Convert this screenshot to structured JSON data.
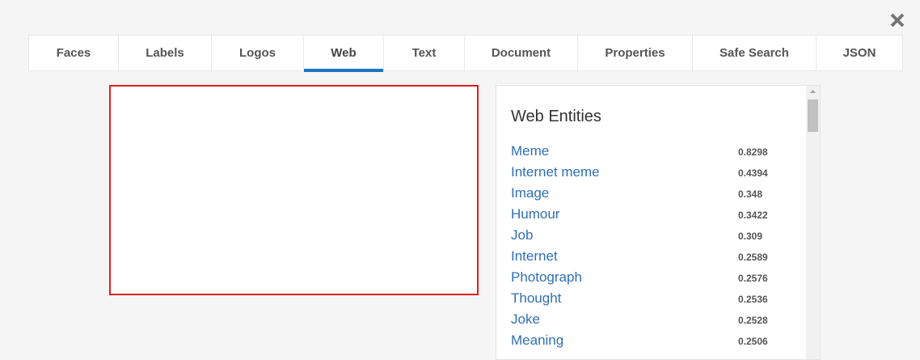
{
  "dialog": {
    "close_icon": "close-icon"
  },
  "tabs": [
    {
      "label": "Faces",
      "active": false
    },
    {
      "label": "Labels",
      "active": false
    },
    {
      "label": "Logos",
      "active": false
    },
    {
      "label": "Web",
      "active": true
    },
    {
      "label": "Text",
      "active": false
    },
    {
      "label": "Document",
      "active": false
    },
    {
      "label": "Properties",
      "active": false
    },
    {
      "label": "Safe Search",
      "active": false
    },
    {
      "label": "JSON",
      "active": false
    }
  ],
  "colors": {
    "accent": "#1a73c8",
    "link": "#2f6fb5",
    "frame_border": "#e02020"
  },
  "web_entities": {
    "title": "Web Entities",
    "items": [
      {
        "name": "Meme",
        "score": "0.8298"
      },
      {
        "name": "Internet meme",
        "score": "0.4394"
      },
      {
        "name": "Image",
        "score": "0.348"
      },
      {
        "name": "Humour",
        "score": "0.3422"
      },
      {
        "name": "Job",
        "score": "0.309"
      },
      {
        "name": "Internet",
        "score": "0.2589"
      },
      {
        "name": "Photograph",
        "score": "0.2576"
      },
      {
        "name": "Thought",
        "score": "0.2536"
      },
      {
        "name": "Joke",
        "score": "0.2528"
      },
      {
        "name": "Meaning",
        "score": "0.2506"
      }
    ]
  }
}
